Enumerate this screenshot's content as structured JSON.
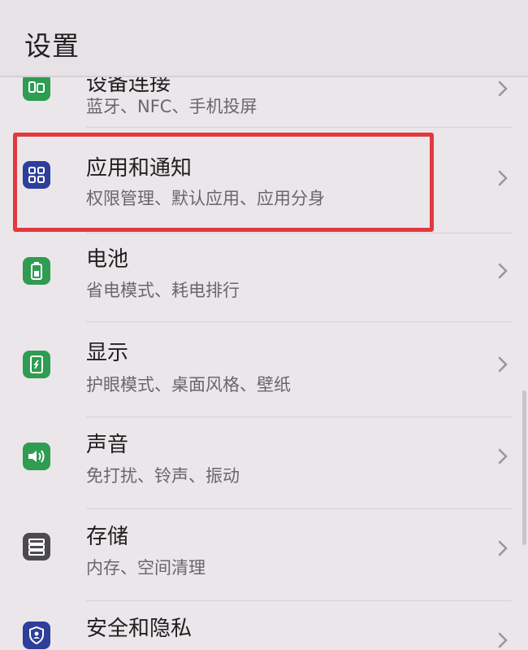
{
  "header": {
    "title": "设置"
  },
  "colors": {
    "green": "#2e9c51",
    "blue": "#2d3f9a",
    "gray": "#4d4a4f",
    "highlight": "#e23a3e"
  },
  "items": [
    {
      "label": "设备连接",
      "sub": "蓝牙、NFC、手机投屏",
      "icon": "device-connect-icon"
    },
    {
      "label": "应用和通知",
      "sub": "权限管理、默认应用、应用分身",
      "icon": "apps-icon"
    },
    {
      "label": "电池",
      "sub": "省电模式、耗电排行",
      "icon": "battery-icon"
    },
    {
      "label": "显示",
      "sub": "护眼模式、桌面风格、壁纸",
      "icon": "display-icon"
    },
    {
      "label": "声音",
      "sub": "免打扰、铃声、振动",
      "icon": "sound-icon"
    },
    {
      "label": "存储",
      "sub": "内存、空间清理",
      "icon": "storage-icon"
    },
    {
      "label": "安全和隐私",
      "sub": "",
      "icon": "security-icon"
    }
  ]
}
